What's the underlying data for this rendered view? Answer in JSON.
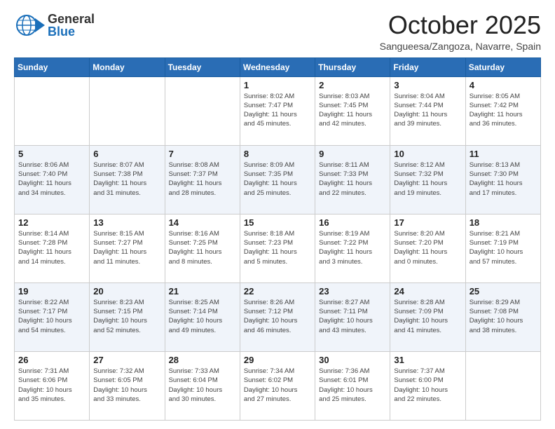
{
  "logo": {
    "general": "General",
    "blue": "Blue"
  },
  "title": "October 2025",
  "location": "Sangueesa/Zangoza, Navarre, Spain",
  "days_of_week": [
    "Sunday",
    "Monday",
    "Tuesday",
    "Wednesday",
    "Thursday",
    "Friday",
    "Saturday"
  ],
  "weeks": [
    [
      {
        "num": "",
        "info": ""
      },
      {
        "num": "",
        "info": ""
      },
      {
        "num": "",
        "info": ""
      },
      {
        "num": "1",
        "info": "Sunrise: 8:02 AM\nSunset: 7:47 PM\nDaylight: 11 hours\nand 45 minutes."
      },
      {
        "num": "2",
        "info": "Sunrise: 8:03 AM\nSunset: 7:45 PM\nDaylight: 11 hours\nand 42 minutes."
      },
      {
        "num": "3",
        "info": "Sunrise: 8:04 AM\nSunset: 7:44 PM\nDaylight: 11 hours\nand 39 minutes."
      },
      {
        "num": "4",
        "info": "Sunrise: 8:05 AM\nSunset: 7:42 PM\nDaylight: 11 hours\nand 36 minutes."
      }
    ],
    [
      {
        "num": "5",
        "info": "Sunrise: 8:06 AM\nSunset: 7:40 PM\nDaylight: 11 hours\nand 34 minutes."
      },
      {
        "num": "6",
        "info": "Sunrise: 8:07 AM\nSunset: 7:38 PM\nDaylight: 11 hours\nand 31 minutes."
      },
      {
        "num": "7",
        "info": "Sunrise: 8:08 AM\nSunset: 7:37 PM\nDaylight: 11 hours\nand 28 minutes."
      },
      {
        "num": "8",
        "info": "Sunrise: 8:09 AM\nSunset: 7:35 PM\nDaylight: 11 hours\nand 25 minutes."
      },
      {
        "num": "9",
        "info": "Sunrise: 8:11 AM\nSunset: 7:33 PM\nDaylight: 11 hours\nand 22 minutes."
      },
      {
        "num": "10",
        "info": "Sunrise: 8:12 AM\nSunset: 7:32 PM\nDaylight: 11 hours\nand 19 minutes."
      },
      {
        "num": "11",
        "info": "Sunrise: 8:13 AM\nSunset: 7:30 PM\nDaylight: 11 hours\nand 17 minutes."
      }
    ],
    [
      {
        "num": "12",
        "info": "Sunrise: 8:14 AM\nSunset: 7:28 PM\nDaylight: 11 hours\nand 14 minutes."
      },
      {
        "num": "13",
        "info": "Sunrise: 8:15 AM\nSunset: 7:27 PM\nDaylight: 11 hours\nand 11 minutes."
      },
      {
        "num": "14",
        "info": "Sunrise: 8:16 AM\nSunset: 7:25 PM\nDaylight: 11 hours\nand 8 minutes."
      },
      {
        "num": "15",
        "info": "Sunrise: 8:18 AM\nSunset: 7:23 PM\nDaylight: 11 hours\nand 5 minutes."
      },
      {
        "num": "16",
        "info": "Sunrise: 8:19 AM\nSunset: 7:22 PM\nDaylight: 11 hours\nand 3 minutes."
      },
      {
        "num": "17",
        "info": "Sunrise: 8:20 AM\nSunset: 7:20 PM\nDaylight: 11 hours\nand 0 minutes."
      },
      {
        "num": "18",
        "info": "Sunrise: 8:21 AM\nSunset: 7:19 PM\nDaylight: 10 hours\nand 57 minutes."
      }
    ],
    [
      {
        "num": "19",
        "info": "Sunrise: 8:22 AM\nSunset: 7:17 PM\nDaylight: 10 hours\nand 54 minutes."
      },
      {
        "num": "20",
        "info": "Sunrise: 8:23 AM\nSunset: 7:15 PM\nDaylight: 10 hours\nand 52 minutes."
      },
      {
        "num": "21",
        "info": "Sunrise: 8:25 AM\nSunset: 7:14 PM\nDaylight: 10 hours\nand 49 minutes."
      },
      {
        "num": "22",
        "info": "Sunrise: 8:26 AM\nSunset: 7:12 PM\nDaylight: 10 hours\nand 46 minutes."
      },
      {
        "num": "23",
        "info": "Sunrise: 8:27 AM\nSunset: 7:11 PM\nDaylight: 10 hours\nand 43 minutes."
      },
      {
        "num": "24",
        "info": "Sunrise: 8:28 AM\nSunset: 7:09 PM\nDaylight: 10 hours\nand 41 minutes."
      },
      {
        "num": "25",
        "info": "Sunrise: 8:29 AM\nSunset: 7:08 PM\nDaylight: 10 hours\nand 38 minutes."
      }
    ],
    [
      {
        "num": "26",
        "info": "Sunrise: 7:31 AM\nSunset: 6:06 PM\nDaylight: 10 hours\nand 35 minutes."
      },
      {
        "num": "27",
        "info": "Sunrise: 7:32 AM\nSunset: 6:05 PM\nDaylight: 10 hours\nand 33 minutes."
      },
      {
        "num": "28",
        "info": "Sunrise: 7:33 AM\nSunset: 6:04 PM\nDaylight: 10 hours\nand 30 minutes."
      },
      {
        "num": "29",
        "info": "Sunrise: 7:34 AM\nSunset: 6:02 PM\nDaylight: 10 hours\nand 27 minutes."
      },
      {
        "num": "30",
        "info": "Sunrise: 7:36 AM\nSunset: 6:01 PM\nDaylight: 10 hours\nand 25 minutes."
      },
      {
        "num": "31",
        "info": "Sunrise: 7:37 AM\nSunset: 6:00 PM\nDaylight: 10 hours\nand 22 minutes."
      },
      {
        "num": "",
        "info": ""
      }
    ]
  ]
}
